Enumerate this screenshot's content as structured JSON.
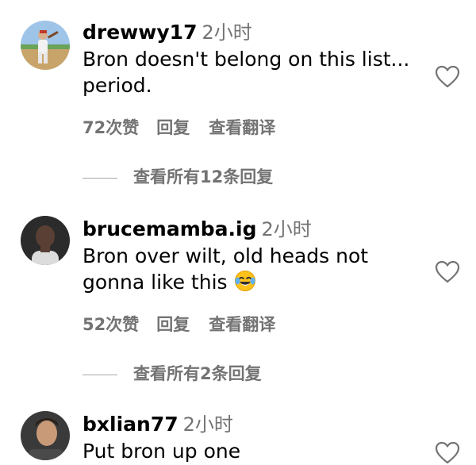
{
  "comments": [
    {
      "username": "drewwy17",
      "time": "2小时",
      "text": "Bron doesn't belong on this list...",
      "text_line2": "period.",
      "likes": "72次赞",
      "reply": "回复",
      "translate": "查看翻译",
      "view_replies": "查看所有12条回复"
    },
    {
      "username": "brucemamba.ig",
      "time": "2小时",
      "text": "Bron over wilt, old heads not",
      "text_line2": "gonna like this",
      "emoji": "face-with-tears-of-joy",
      "likes": "52次赞",
      "reply": "回复",
      "translate": "查看翻译",
      "view_replies": "查看所有2条回复"
    },
    {
      "username": "bxlian77",
      "time": "2小时",
      "text": "Put bron up one"
    }
  ],
  "icons": {
    "like": "heart-outline-icon"
  },
  "colors": {
    "secondary_text": "#737373",
    "primary_text": "#000000"
  }
}
